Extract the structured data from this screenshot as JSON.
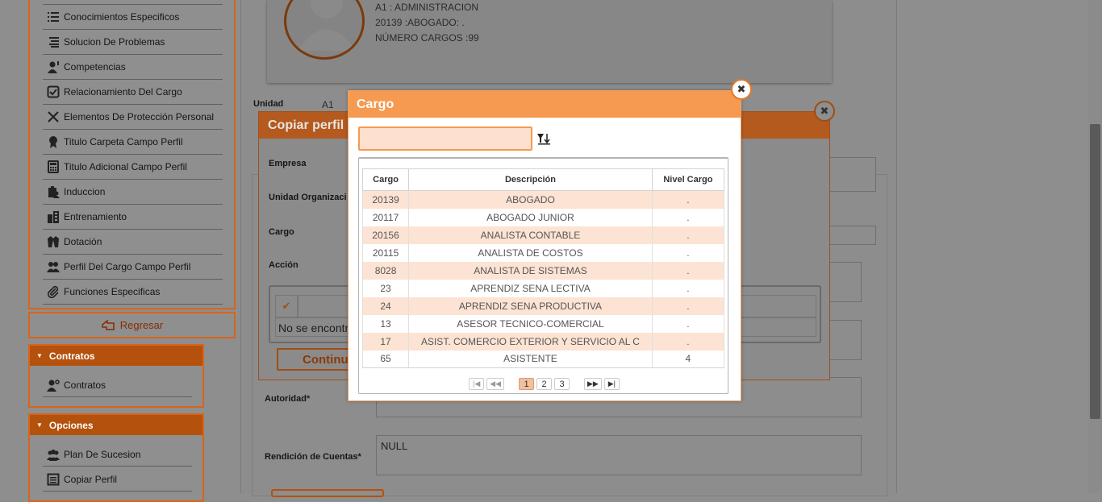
{
  "sidebar": {
    "items": [
      {
        "label": "Conocimientos Especificos",
        "icon": "list-icon"
      },
      {
        "label": "Solucion De Problemas",
        "icon": "align-list-icon"
      },
      {
        "label": "Competencias",
        "icon": "user-star-icon"
      },
      {
        "label": "Relacionamiento Del Cargo",
        "icon": "checkbox-icon"
      },
      {
        "label": "Elementos De Protección Personal",
        "icon": "tools-icon"
      },
      {
        "label": "Titulo Carpeta Campo Perfil",
        "icon": "badge-icon"
      },
      {
        "label": "Titulo Adicional Campo Perfil",
        "icon": "calculator-icon"
      },
      {
        "label": "Induccion",
        "icon": "clipboard-user-icon"
      },
      {
        "label": "Entrenamiento",
        "icon": "building-icon"
      },
      {
        "label": "Dotación",
        "icon": "jacket-icon"
      },
      {
        "label": "Perfil Del Cargo Campo Perfil",
        "icon": "users-icon"
      },
      {
        "label": "Funciones Especificas",
        "icon": "paperclip-icon"
      }
    ],
    "back_label": "Regresar",
    "contratos": {
      "title": "Contratos",
      "items": [
        {
          "label": "Contratos"
        }
      ]
    },
    "opciones": {
      "title": "Opciones",
      "items": [
        {
          "label": "Plan De Sucesion"
        },
        {
          "label": "Copiar Perfil"
        }
      ]
    }
  },
  "profile": {
    "line1": "A1 : ADMINISTRACION",
    "line2": "20139 :ABOGADO: .",
    "line3": "NÚMERO CARGOS :99"
  },
  "background_form": {
    "unidad_label": "Unidad",
    "unidad_value": "A1",
    "autoridad_label": "Autoridad",
    "rendicion_label": "Rendición de Cuentas",
    "rendicion_value": "NULL",
    "required_mark": "*"
  },
  "copy_dialog": {
    "title": "Copiar perfil",
    "empresa_label": "Empresa",
    "unidad_label": "Unidad Organizaci",
    "cargo_label": "Cargo",
    "accion_label": "Acción",
    "no_results": "No se encontr",
    "continue_label": "Continu"
  },
  "cargo_modal": {
    "title": "Cargo",
    "search_value": "",
    "columns": [
      "Cargo",
      "Descripción",
      "Nivel Cargo"
    ],
    "rows": [
      {
        "cargo": "20139",
        "descripcion": "ABOGADO",
        "nivel": "."
      },
      {
        "cargo": "20117",
        "descripcion": "ABOGADO JUNIOR",
        "nivel": "."
      },
      {
        "cargo": "20156",
        "descripcion": "ANALISTA CONTABLE",
        "nivel": "."
      },
      {
        "cargo": "20115",
        "descripcion": "ANALISTA DE COSTOS",
        "nivel": "."
      },
      {
        "cargo": "8028",
        "descripcion": "ANALISTA DE SISTEMAS",
        "nivel": "."
      },
      {
        "cargo": "23",
        "descripcion": "APRENDIZ SENA LECTIVA",
        "nivel": "."
      },
      {
        "cargo": "24",
        "descripcion": "APRENDIZ SENA PRODUCTIVA",
        "nivel": "."
      },
      {
        "cargo": "13",
        "descripcion": "ASESOR TECNICO-COMERCIAL",
        "nivel": "."
      },
      {
        "cargo": "17",
        "descripcion": "ASIST. COMERCIO EXTERIOR Y SERVICIO AL C",
        "nivel": "."
      },
      {
        "cargo": "65",
        "descripcion": "ASISTENTE",
        "nivel": "4"
      }
    ],
    "pager": {
      "first": "|◀",
      "prev": "◀◀",
      "pages": [
        "1",
        "2",
        "3"
      ],
      "current": "1",
      "next": "▶▶",
      "last": "▶|"
    }
  },
  "colors": {
    "accent": "#f59a50",
    "accent_dark": "#d9641a",
    "row_highlight": "#fde3d3"
  }
}
